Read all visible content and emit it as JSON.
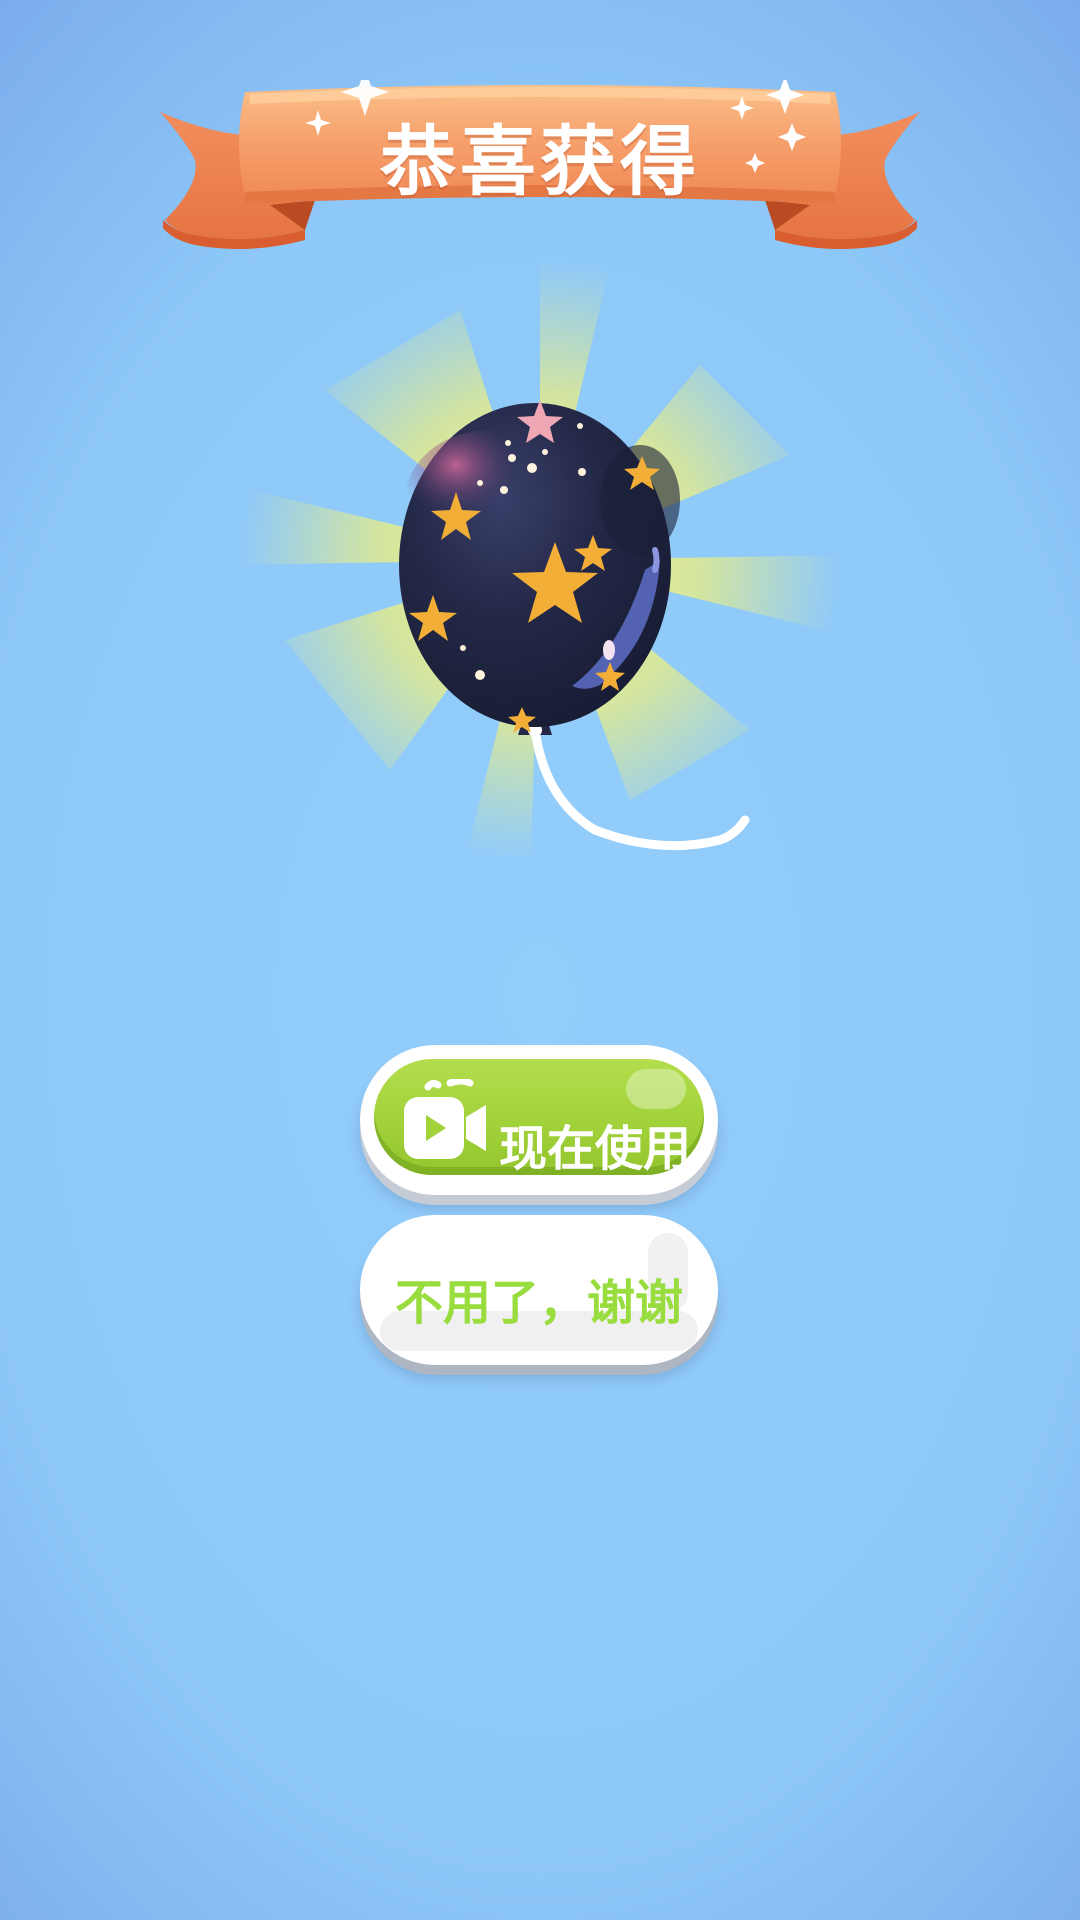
{
  "banner": {
    "title": "恭喜获得"
  },
  "reward": {
    "item_icon": "starry-balloon-icon",
    "glow_icon": "light-rays"
  },
  "buttons": {
    "use_now": {
      "label": "现在使用",
      "icon": "video-camera-icon"
    },
    "decline": {
      "label": "不用了，谢谢"
    }
  },
  "colors": {
    "background": "#8ec8f8",
    "banner": "#f5a06d",
    "banner_dark": "#e27444",
    "primary_button": "#a1d23a",
    "decline_text": "#98dc3e",
    "balloon": "#202743",
    "star": "#f3ae38"
  }
}
